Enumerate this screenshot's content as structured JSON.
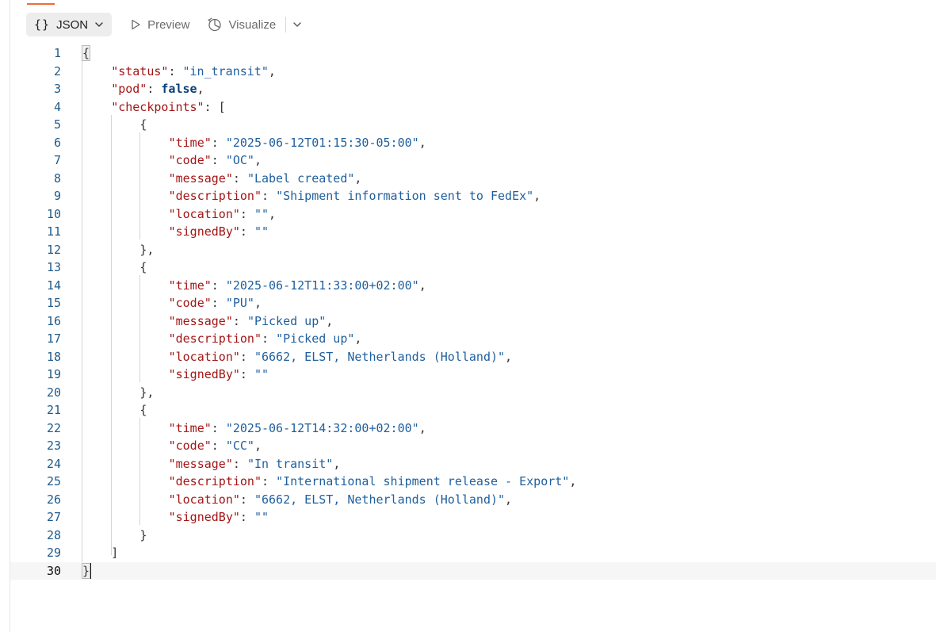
{
  "toolbar": {
    "json_label": "JSON",
    "json_braces": "{}",
    "preview_label": "Preview",
    "visualize_label": "Visualize"
  },
  "colors": {
    "accent": "#f26b3a",
    "key": "#a31515",
    "string": "#1f5f9e",
    "boolean": "#0d3f78",
    "line_number": "#1e5a8a"
  },
  "icons": {
    "json_dropdown": "chevron-down-icon",
    "preview": "play-outline-icon",
    "visualize": "visualize-icon",
    "more": "chevron-down-icon"
  },
  "editor": {
    "active_line": 30,
    "lines": [
      {
        "n": "1",
        "indent": 0,
        "tokens": [
          {
            "t": "{",
            "c": "p",
            "hl": true
          }
        ]
      },
      {
        "n": "2",
        "indent": 1,
        "tokens": [
          {
            "t": "\"status\"",
            "c": "k"
          },
          {
            "t": ": ",
            "c": "p"
          },
          {
            "t": "\"in_transit\"",
            "c": "s"
          },
          {
            "t": ",",
            "c": "p"
          }
        ]
      },
      {
        "n": "3",
        "indent": 1,
        "tokens": [
          {
            "t": "\"pod\"",
            "c": "k"
          },
          {
            "t": ": ",
            "c": "p"
          },
          {
            "t": "false",
            "c": "b"
          },
          {
            "t": ",",
            "c": "p"
          }
        ]
      },
      {
        "n": "4",
        "indent": 1,
        "tokens": [
          {
            "t": "\"checkpoints\"",
            "c": "k"
          },
          {
            "t": ": [",
            "c": "p"
          }
        ]
      },
      {
        "n": "5",
        "indent": 2,
        "tokens": [
          {
            "t": "{",
            "c": "p"
          }
        ]
      },
      {
        "n": "6",
        "indent": 3,
        "tokens": [
          {
            "t": "\"time\"",
            "c": "k"
          },
          {
            "t": ": ",
            "c": "p"
          },
          {
            "t": "\"2025-06-12T01:15:30-05:00\"",
            "c": "s"
          },
          {
            "t": ",",
            "c": "p"
          }
        ]
      },
      {
        "n": "7",
        "indent": 3,
        "tokens": [
          {
            "t": "\"code\"",
            "c": "k"
          },
          {
            "t": ": ",
            "c": "p"
          },
          {
            "t": "\"OC\"",
            "c": "s"
          },
          {
            "t": ",",
            "c": "p"
          }
        ]
      },
      {
        "n": "8",
        "indent": 3,
        "tokens": [
          {
            "t": "\"message\"",
            "c": "k"
          },
          {
            "t": ": ",
            "c": "p"
          },
          {
            "t": "\"Label created\"",
            "c": "s"
          },
          {
            "t": ",",
            "c": "p"
          }
        ]
      },
      {
        "n": "9",
        "indent": 3,
        "tokens": [
          {
            "t": "\"description\"",
            "c": "k"
          },
          {
            "t": ": ",
            "c": "p"
          },
          {
            "t": "\"Shipment information sent to FedEx\"",
            "c": "s"
          },
          {
            "t": ",",
            "c": "p"
          }
        ]
      },
      {
        "n": "10",
        "indent": 3,
        "tokens": [
          {
            "t": "\"location\"",
            "c": "k"
          },
          {
            "t": ": ",
            "c": "p"
          },
          {
            "t": "\"\"",
            "c": "s"
          },
          {
            "t": ",",
            "c": "p"
          }
        ]
      },
      {
        "n": "11",
        "indent": 3,
        "tokens": [
          {
            "t": "\"signedBy\"",
            "c": "k"
          },
          {
            "t": ": ",
            "c": "p"
          },
          {
            "t": "\"\"",
            "c": "s"
          }
        ]
      },
      {
        "n": "12",
        "indent": 2,
        "tokens": [
          {
            "t": "},",
            "c": "p"
          }
        ]
      },
      {
        "n": "13",
        "indent": 2,
        "tokens": [
          {
            "t": "{",
            "c": "p"
          }
        ]
      },
      {
        "n": "14",
        "indent": 3,
        "tokens": [
          {
            "t": "\"time\"",
            "c": "k"
          },
          {
            "t": ": ",
            "c": "p"
          },
          {
            "t": "\"2025-06-12T11:33:00+02:00\"",
            "c": "s"
          },
          {
            "t": ",",
            "c": "p"
          }
        ]
      },
      {
        "n": "15",
        "indent": 3,
        "tokens": [
          {
            "t": "\"code\"",
            "c": "k"
          },
          {
            "t": ": ",
            "c": "p"
          },
          {
            "t": "\"PU\"",
            "c": "s"
          },
          {
            "t": ",",
            "c": "p"
          }
        ]
      },
      {
        "n": "16",
        "indent": 3,
        "tokens": [
          {
            "t": "\"message\"",
            "c": "k"
          },
          {
            "t": ": ",
            "c": "p"
          },
          {
            "t": "\"Picked up\"",
            "c": "s"
          },
          {
            "t": ",",
            "c": "p"
          }
        ]
      },
      {
        "n": "17",
        "indent": 3,
        "tokens": [
          {
            "t": "\"description\"",
            "c": "k"
          },
          {
            "t": ": ",
            "c": "p"
          },
          {
            "t": "\"Picked up\"",
            "c": "s"
          },
          {
            "t": ",",
            "c": "p"
          }
        ]
      },
      {
        "n": "18",
        "indent": 3,
        "tokens": [
          {
            "t": "\"location\"",
            "c": "k"
          },
          {
            "t": ": ",
            "c": "p"
          },
          {
            "t": "\"6662, ELST, Netherlands (Holland)\"",
            "c": "s"
          },
          {
            "t": ",",
            "c": "p"
          }
        ]
      },
      {
        "n": "19",
        "indent": 3,
        "tokens": [
          {
            "t": "\"signedBy\"",
            "c": "k"
          },
          {
            "t": ": ",
            "c": "p"
          },
          {
            "t": "\"\"",
            "c": "s"
          }
        ]
      },
      {
        "n": "20",
        "indent": 2,
        "tokens": [
          {
            "t": "},",
            "c": "p"
          }
        ]
      },
      {
        "n": "21",
        "indent": 2,
        "tokens": [
          {
            "t": "{",
            "c": "p"
          }
        ]
      },
      {
        "n": "22",
        "indent": 3,
        "tokens": [
          {
            "t": "\"time\"",
            "c": "k"
          },
          {
            "t": ": ",
            "c": "p"
          },
          {
            "t": "\"2025-06-12T14:32:00+02:00\"",
            "c": "s"
          },
          {
            "t": ",",
            "c": "p"
          }
        ]
      },
      {
        "n": "23",
        "indent": 3,
        "tokens": [
          {
            "t": "\"code\"",
            "c": "k"
          },
          {
            "t": ": ",
            "c": "p"
          },
          {
            "t": "\"CC\"",
            "c": "s"
          },
          {
            "t": ",",
            "c": "p"
          }
        ]
      },
      {
        "n": "24",
        "indent": 3,
        "tokens": [
          {
            "t": "\"message\"",
            "c": "k"
          },
          {
            "t": ": ",
            "c": "p"
          },
          {
            "t": "\"In transit\"",
            "c": "s"
          },
          {
            "t": ",",
            "c": "p"
          }
        ]
      },
      {
        "n": "25",
        "indent": 3,
        "tokens": [
          {
            "t": "\"description\"",
            "c": "k"
          },
          {
            "t": ": ",
            "c": "p"
          },
          {
            "t": "\"International shipment release - Export\"",
            "c": "s"
          },
          {
            "t": ",",
            "c": "p"
          }
        ]
      },
      {
        "n": "26",
        "indent": 3,
        "tokens": [
          {
            "t": "\"location\"",
            "c": "k"
          },
          {
            "t": ": ",
            "c": "p"
          },
          {
            "t": "\"6662, ELST, Netherlands (Holland)\"",
            "c": "s"
          },
          {
            "t": ",",
            "c": "p"
          }
        ]
      },
      {
        "n": "27",
        "indent": 3,
        "tokens": [
          {
            "t": "\"signedBy\"",
            "c": "k"
          },
          {
            "t": ": ",
            "c": "p"
          },
          {
            "t": "\"\"",
            "c": "s"
          }
        ]
      },
      {
        "n": "28",
        "indent": 2,
        "tokens": [
          {
            "t": "}",
            "c": "p"
          }
        ]
      },
      {
        "n": "29",
        "indent": 1,
        "tokens": [
          {
            "t": "]",
            "c": "p"
          }
        ]
      },
      {
        "n": "30",
        "indent": 0,
        "tokens": [
          {
            "t": "}",
            "c": "p",
            "hl": true
          }
        ],
        "cursor": true
      }
    ]
  }
}
